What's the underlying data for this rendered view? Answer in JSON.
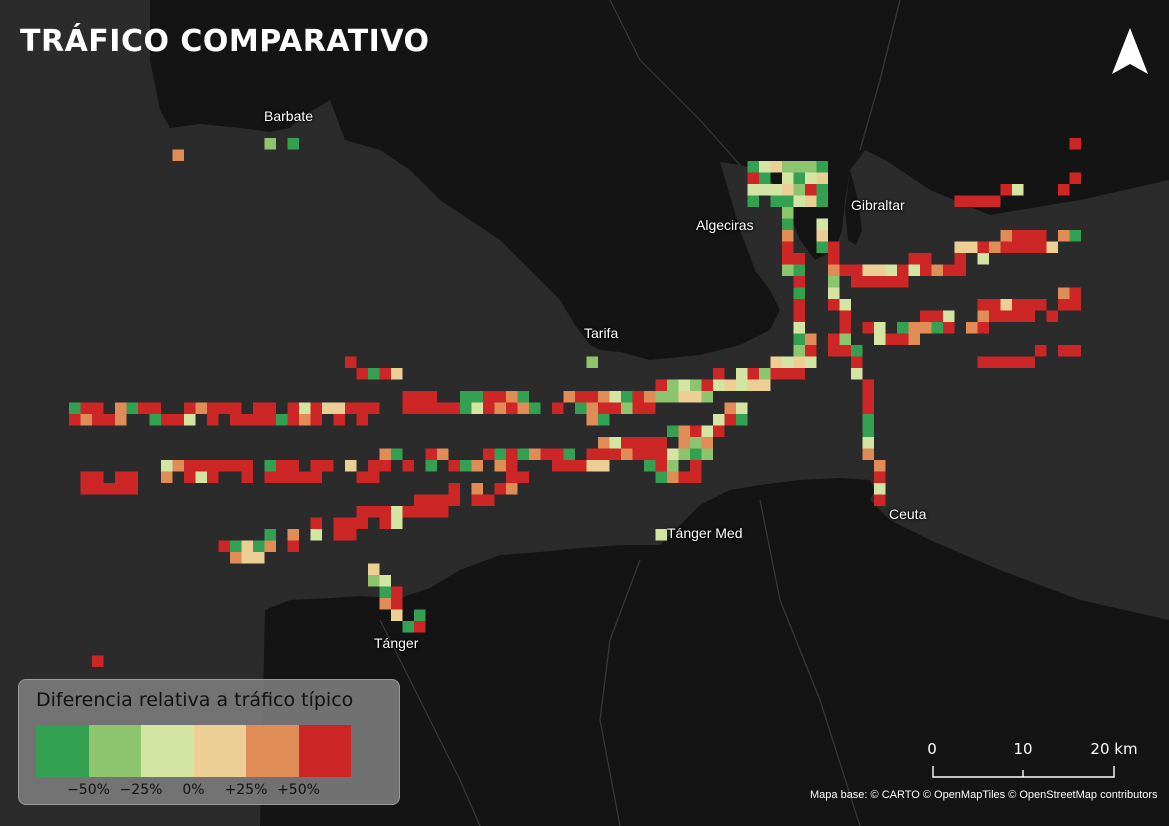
{
  "title": "TRÁFICO COMPARATIVO",
  "places": [
    {
      "id": "barbate",
      "name": "Barbate"
    },
    {
      "id": "algeciras",
      "name": "Algeciras"
    },
    {
      "id": "gibraltar",
      "name": "Gibraltar"
    },
    {
      "id": "tarifa",
      "name": "Tarifa"
    },
    {
      "id": "tanger-med",
      "name": "Tánger Med"
    },
    {
      "id": "ceuta",
      "name": "Ceuta"
    },
    {
      "id": "tanger",
      "name": "Tánger"
    }
  ],
  "legend": {
    "title": "Diferencia relativa a tráfico típico",
    "ticks": [
      "−50%",
      "−25%",
      "0%",
      "+25%",
      "+50%"
    ],
    "classes": [
      {
        "color": "#33a052"
      },
      {
        "color": "#8dc56e"
      },
      {
        "color": "#d3e4a3"
      },
      {
        "color": "#ebcf95"
      },
      {
        "color": "#df8c57"
      },
      {
        "color": "#cc2626"
      }
    ]
  },
  "scale": {
    "labels": [
      "0",
      "10",
      "20 km"
    ]
  },
  "attribution": "Mapa base: © CARTO © OpenMapTiles © OpenStreetMap contributors",
  "colors": {
    "sea": "#2b2b2b",
    "land": "#141414",
    "text": "#ffffff",
    "legend_bg": "#787878"
  },
  "icons": {
    "north": "north-arrow-icon"
  }
}
